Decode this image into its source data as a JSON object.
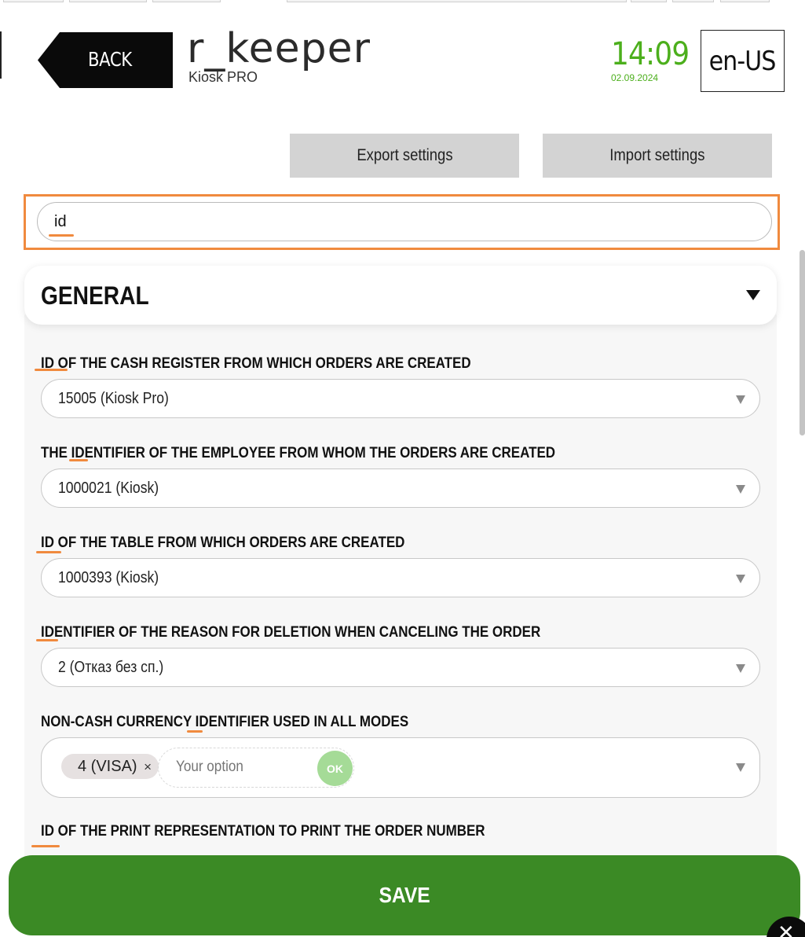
{
  "header": {
    "back_label": "BACK",
    "app_title": "r_keeper",
    "app_subtitle": "Kiosk PRO",
    "time": "14:09",
    "date": "02.09.2024",
    "language": "en-US"
  },
  "actions": {
    "export_label": "Export settings",
    "import_label": "Import settings"
  },
  "search": {
    "value": "id"
  },
  "section": {
    "title": "GENERAL",
    "fields": [
      {
        "label": "ID OF THE CASH REGISTER FROM WHICH ORDERS ARE CREATED",
        "value": "15005 (Kiosk Pro)"
      },
      {
        "label": "THE IDENTIFIER OF THE EMPLOYEE FROM WHOM THE ORDERS ARE CREATED",
        "value": "1000021 (Kiosk)"
      },
      {
        "label": "ID OF THE TABLE FROM WHICH ORDERS ARE CREATED",
        "value": "1000393 (Kiosk)"
      },
      {
        "label": "IDENTIFIER OF THE REASON FOR DELETION WHEN CANCELING THE ORDER",
        "value": "2 (Отказ без сп.)"
      },
      {
        "label": "NON-CASH CURRENCY IDENTIFIER USED IN ALL MODES",
        "chip": "4 (VISA)",
        "chip_remove": "×",
        "option_placeholder": "Your option",
        "ok_label": "OK"
      },
      {
        "label": "ID OF THE PRINT REPRESENTATION TO PRINT THE ORDER NUMBER"
      }
    ]
  },
  "footer": {
    "save_label": "SAVE"
  },
  "colors": {
    "accent_green": "#3b8a25",
    "clock_green": "#4caf1c",
    "highlight_orange": "#f08a3e"
  }
}
